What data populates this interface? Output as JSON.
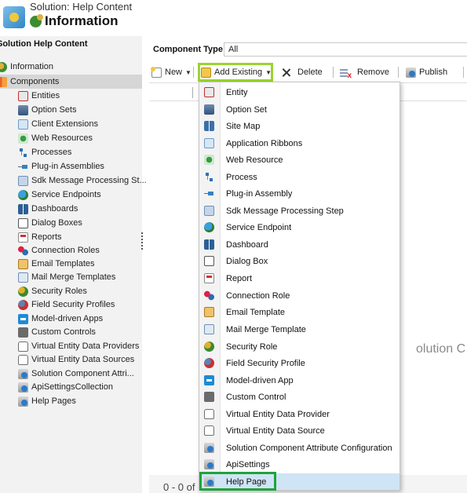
{
  "header": {
    "subtitle": "Solution: Help Content",
    "title": "Information"
  },
  "leftnav": {
    "section": "Solution Help Content",
    "items": [
      {
        "label": "Information",
        "icon": "information-icon"
      },
      {
        "label": "Components",
        "icon": "components-icon",
        "selected": true
      },
      {
        "label": "Entities",
        "icon": "entity-icon"
      },
      {
        "label": "Option Sets",
        "icon": "option-set-icon"
      },
      {
        "label": "Client Extensions",
        "icon": "client-extensions-icon"
      },
      {
        "label": "Web Resources",
        "icon": "web-resource-icon"
      },
      {
        "label": "Processes",
        "icon": "process-icon"
      },
      {
        "label": "Plug-in Assemblies",
        "icon": "plugin-assembly-icon"
      },
      {
        "label": "Sdk Message Processing St...",
        "icon": "sdk-message-icon"
      },
      {
        "label": "Service Endpoints",
        "icon": "service-endpoint-icon"
      },
      {
        "label": "Dashboards",
        "icon": "dashboard-icon"
      },
      {
        "label": "Dialog Boxes",
        "icon": "dialog-box-icon"
      },
      {
        "label": "Reports",
        "icon": "report-icon"
      },
      {
        "label": "Connection Roles",
        "icon": "connection-role-icon"
      },
      {
        "label": "Email Templates",
        "icon": "email-template-icon"
      },
      {
        "label": "Mail Merge Templates",
        "icon": "mail-merge-icon"
      },
      {
        "label": "Security Roles",
        "icon": "security-role-icon"
      },
      {
        "label": "Field Security Profiles",
        "icon": "field-security-icon"
      },
      {
        "label": "Model-driven Apps",
        "icon": "model-driven-app-icon"
      },
      {
        "label": "Custom Controls",
        "icon": "custom-control-icon"
      },
      {
        "label": "Virtual Entity Data Providers",
        "icon": "virtual-entity-provider-icon"
      },
      {
        "label": "Virtual Entity Data Sources",
        "icon": "virtual-entity-source-icon"
      },
      {
        "label": "Solution Component Attri...",
        "icon": "solution-component-icon"
      },
      {
        "label": "ApiSettingsCollection",
        "icon": "api-settings-icon"
      },
      {
        "label": "Help Pages",
        "icon": "help-page-icon"
      }
    ]
  },
  "component_type": {
    "label": "Component Type",
    "value": "All"
  },
  "toolbar": {
    "new_label": "New",
    "add_existing_label": "Add Existing",
    "delete_label": "Delete",
    "remove_label": "Remove",
    "publish_label": "Publish"
  },
  "dropdown": {
    "items": [
      {
        "label": "Entity",
        "icon": "entity-icon"
      },
      {
        "label": "Option Set",
        "icon": "option-set-icon"
      },
      {
        "label": "Site Map",
        "icon": "site-map-icon"
      },
      {
        "label": "Application Ribbons",
        "icon": "ribbon-icon"
      },
      {
        "label": "Web Resource",
        "icon": "web-resource-icon"
      },
      {
        "label": "Process",
        "icon": "process-icon"
      },
      {
        "label": "Plug-in Assembly",
        "icon": "plugin-assembly-icon"
      },
      {
        "label": "Sdk Message Processing Step",
        "icon": "sdk-message-icon"
      },
      {
        "label": "Service Endpoint",
        "icon": "service-endpoint-icon"
      },
      {
        "label": "Dashboard",
        "icon": "dashboard-icon"
      },
      {
        "label": "Dialog Box",
        "icon": "dialog-box-icon"
      },
      {
        "label": "Report",
        "icon": "report-icon"
      },
      {
        "label": "Connection Role",
        "icon": "connection-role-icon"
      },
      {
        "label": "Email Template",
        "icon": "email-template-icon"
      },
      {
        "label": "Mail Merge Template",
        "icon": "mail-merge-icon"
      },
      {
        "label": "Security Role",
        "icon": "security-role-icon"
      },
      {
        "label": "Field Security Profile",
        "icon": "field-security-icon"
      },
      {
        "label": "Model-driven App",
        "icon": "model-driven-app-icon"
      },
      {
        "label": "Custom Control",
        "icon": "custom-control-icon"
      },
      {
        "label": "Virtual Entity Data Provider",
        "icon": "virtual-entity-provider-icon"
      },
      {
        "label": "Virtual Entity Data Source",
        "icon": "virtual-entity-source-icon"
      },
      {
        "label": "Solution Component Attribute Configuration",
        "icon": "solution-component-icon"
      },
      {
        "label": "ApiSettings",
        "icon": "api-settings-icon"
      },
      {
        "label": "Help Page",
        "icon": "help-page-icon",
        "highlighted": true
      }
    ]
  },
  "background_text": "olution C",
  "footer": {
    "range": "0 - 0 of"
  },
  "colors": {
    "add_existing_highlight": "#9bd42e",
    "help_page_highlight": "#1fa33a",
    "selected_bg": "#cfe4f5",
    "nav_bg": "#f2f2f2"
  }
}
